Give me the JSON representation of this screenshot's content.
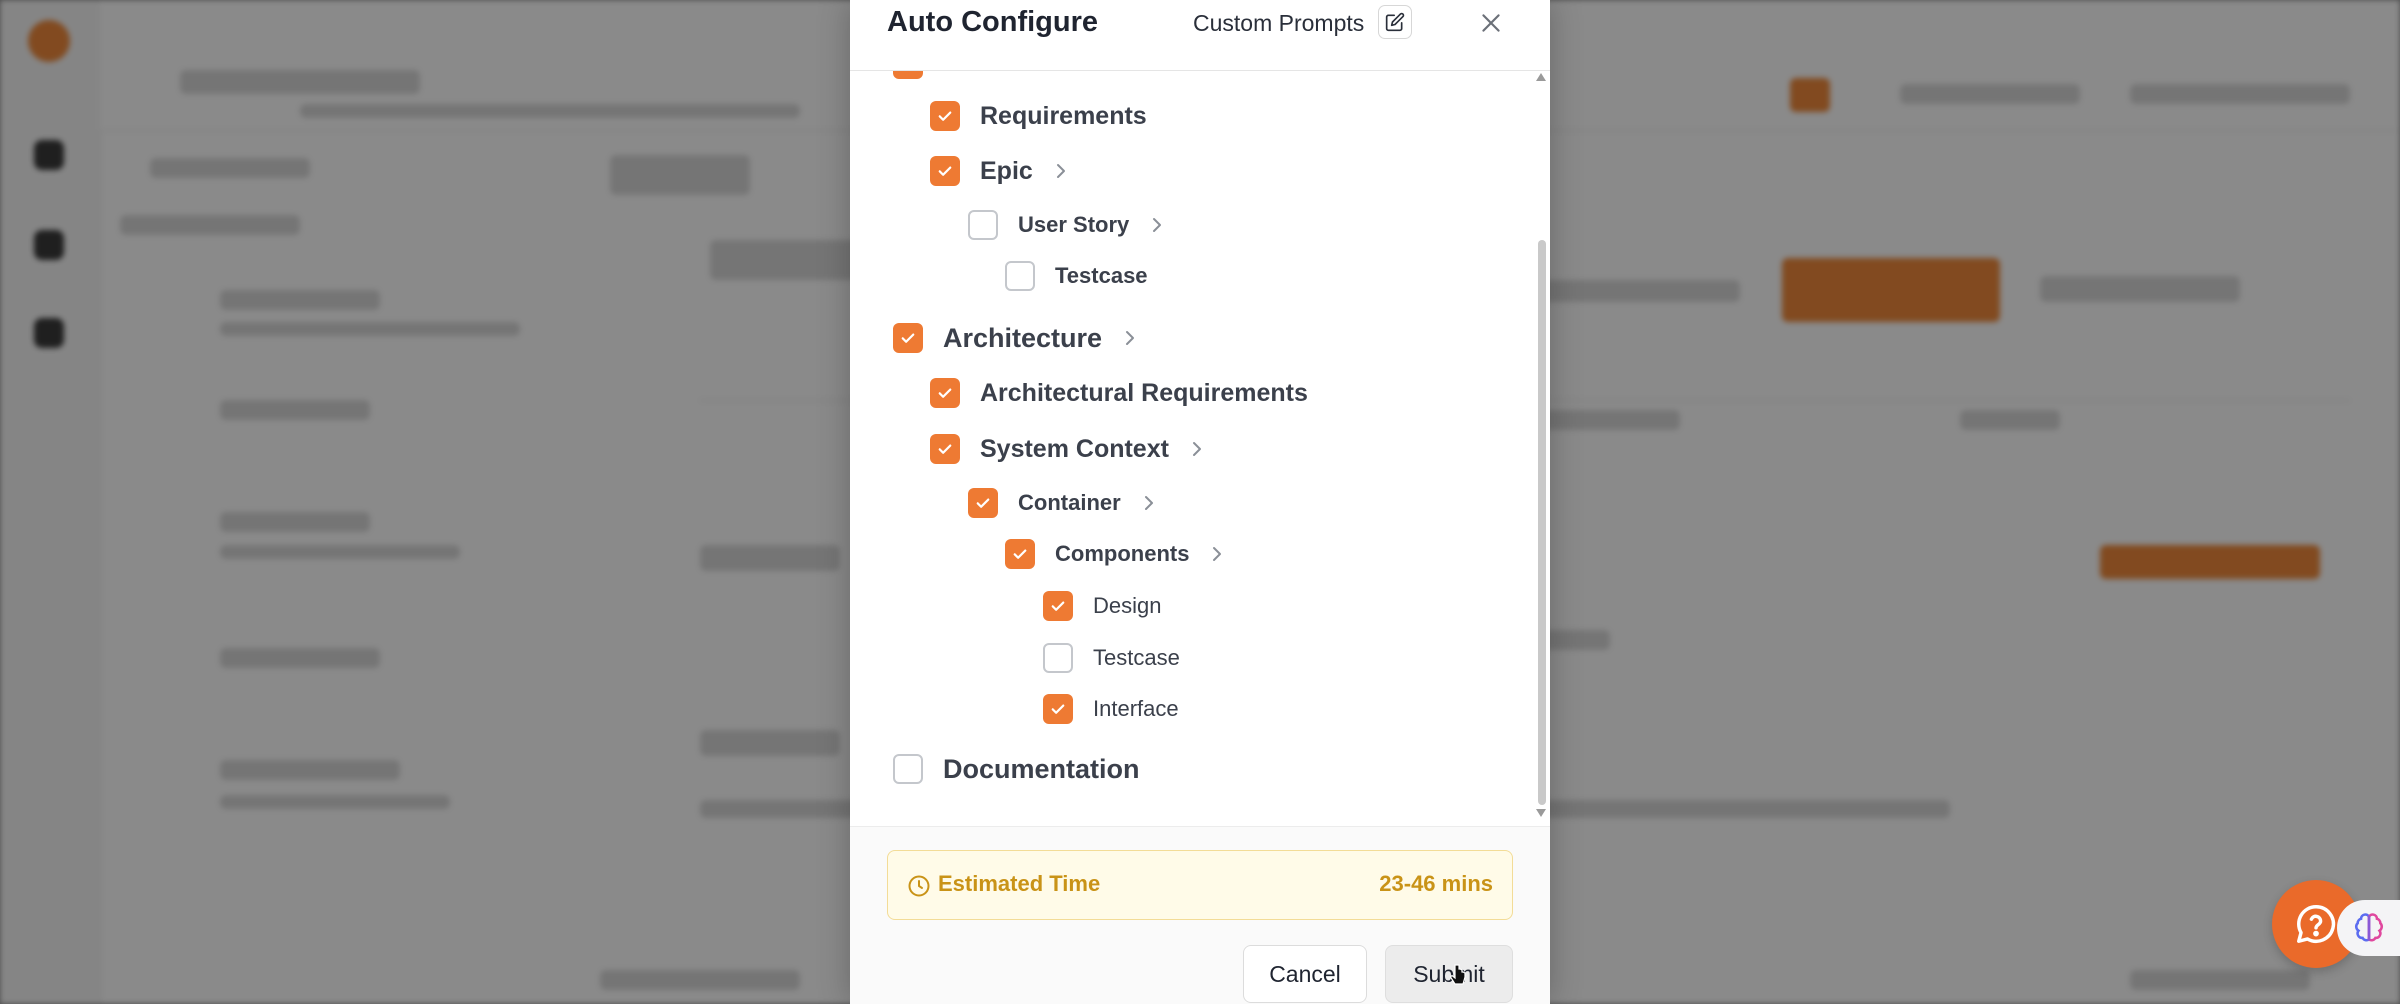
{
  "modal": {
    "title": "Auto Configure",
    "custom_prompts_label": "Custom Prompts",
    "tree": [
      {
        "label": "Requirements",
        "checked": true,
        "level": 1,
        "expandable": false
      },
      {
        "label": "Epic",
        "checked": true,
        "level": 1,
        "expandable": true
      },
      {
        "label": "User Story",
        "checked": false,
        "level": 2,
        "expandable": true
      },
      {
        "label": "Testcase",
        "checked": false,
        "level": 3,
        "expandable": false
      },
      {
        "label": "Architecture",
        "checked": true,
        "level": 0,
        "expandable": true
      },
      {
        "label": "Architectural Requirements",
        "checked": true,
        "level": 1,
        "expandable": false
      },
      {
        "label": "System Context",
        "checked": true,
        "level": 1,
        "expandable": true
      },
      {
        "label": "Container",
        "checked": true,
        "level": 2,
        "expandable": true
      },
      {
        "label": "Components",
        "checked": true,
        "level": 3,
        "expandable": true
      },
      {
        "label": "Design",
        "checked": true,
        "level": 4,
        "expandable": false
      },
      {
        "label": "Testcase",
        "checked": false,
        "level": 4,
        "expandable": false
      },
      {
        "label": "Interface",
        "checked": true,
        "level": 4,
        "expandable": false
      },
      {
        "label": "Documentation",
        "checked": false,
        "level": 0,
        "expandable": false
      }
    ],
    "estimated_time_label": "Estimated Time",
    "estimated_time_value": "23-46 mins",
    "cancel_label": "Cancel",
    "submit_label": "Submit"
  },
  "colors": {
    "accent": "#ee7a33",
    "estimate_text": "#c99317",
    "estimate_bg": "#fffbe8"
  },
  "icons": {
    "edit": "edit-icon",
    "close": "close-icon",
    "chevron": "chevron-right-icon",
    "clock": "clock-icon",
    "help": "help-chat-icon",
    "brain": "brain-icon"
  }
}
